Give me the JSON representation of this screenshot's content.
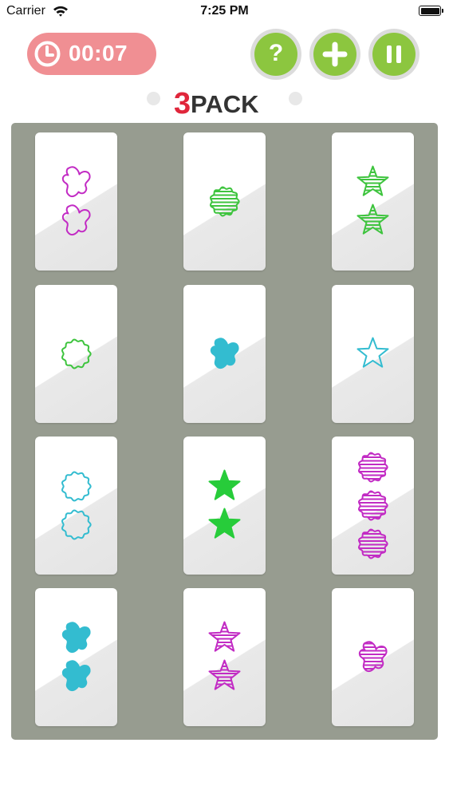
{
  "status_bar": {
    "carrier": "Carrier",
    "time": "7:25 PM"
  },
  "header": {
    "timer": "00:07",
    "help_label": "?",
    "buttons": [
      "help-icon",
      "plus-icon",
      "pause-icon"
    ],
    "button_color": "#8cc63f",
    "timer_color": "#f08f93",
    "logo": {
      "text": "3PACK",
      "digit_color": "#e0263b",
      "word_color": "#333333"
    }
  },
  "board": {
    "background": "#979c90",
    "cards": [
      {
        "count": 2,
        "shape": "splat",
        "fill": "outline",
        "color": "#c22bc4"
      },
      {
        "count": 1,
        "shape": "flower",
        "fill": "striped",
        "color": "#3ec43e"
      },
      {
        "count": 2,
        "shape": "star",
        "fill": "striped",
        "color": "#3ec43e"
      },
      {
        "count": 1,
        "shape": "flower",
        "fill": "outline",
        "color": "#3ec43e"
      },
      {
        "count": 1,
        "shape": "splat",
        "fill": "solid",
        "color": "#33bcd0"
      },
      {
        "count": 1,
        "shape": "star",
        "fill": "outline",
        "color": "#33bcd0"
      },
      {
        "count": 2,
        "shape": "flower",
        "fill": "outline",
        "color": "#33bcd0"
      },
      {
        "count": 2,
        "shape": "star",
        "fill": "solid",
        "color": "#27cc3a"
      },
      {
        "count": 3,
        "shape": "flower",
        "fill": "striped",
        "color": "#c22bc4"
      },
      {
        "count": 2,
        "shape": "splat",
        "fill": "solid",
        "color": "#33bcd0"
      },
      {
        "count": 2,
        "shape": "star",
        "fill": "striped",
        "color": "#c22bc4"
      },
      {
        "count": 1,
        "shape": "splat",
        "fill": "striped",
        "color": "#c22bc4"
      }
    ]
  }
}
